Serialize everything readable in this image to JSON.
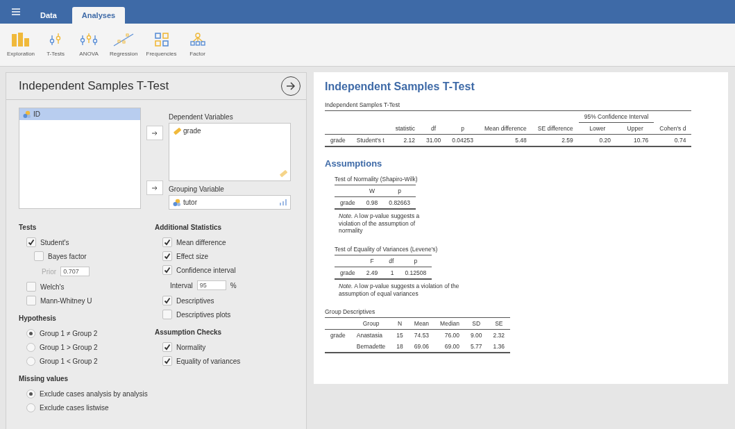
{
  "tabs": [
    {
      "label": "Data",
      "selected": false
    },
    {
      "label": "Analyses",
      "selected": true
    }
  ],
  "ribbon": [
    {
      "kind": "exploration",
      "label": "Exploration"
    },
    {
      "kind": "ttests",
      "label": "T-Tests"
    },
    {
      "kind": "anova",
      "label": "ANOVA"
    },
    {
      "kind": "regression",
      "label": "Regression"
    },
    {
      "kind": "frequencies",
      "label": "Frequencies"
    },
    {
      "kind": "factor",
      "label": "Factor"
    }
  ],
  "panel": {
    "title": "Independent Samples T-Test",
    "available": [
      {
        "name": "ID",
        "kind": "nominal",
        "selected": true
      }
    ],
    "dependent": {
      "label": "Dependent Variables",
      "items": [
        {
          "name": "grade",
          "kind": "scale"
        }
      ]
    },
    "grouping": {
      "label": "Grouping Variable",
      "items": [
        {
          "name": "tutor",
          "kind": "nominal"
        }
      ]
    }
  },
  "options": {
    "columns": [
      {
        "sections": [
          {
            "title": "Tests",
            "items": [
              {
                "kind": "checkbox",
                "label": "Student's",
                "checked": true,
                "children": [
                  {
                    "kind": "checkbox",
                    "label": "Bayes factor",
                    "checked": false,
                    "children": [
                      {
                        "kind": "field",
                        "label": "Prior",
                        "value": "0.707",
                        "disabled": true
                      }
                    ]
                  }
                ]
              },
              {
                "kind": "checkbox",
                "label": "Welch's",
                "checked": false
              },
              {
                "kind": "checkbox",
                "label": "Mann-Whitney U",
                "checked": false
              }
            ]
          },
          {
            "title": "Hypothesis",
            "items": [
              {
                "kind": "radio",
                "label": "Group 1 ≠ Group 2",
                "selected": true
              },
              {
                "kind": "radio",
                "label": "Group 1 > Group 2",
                "selected": false
              },
              {
                "kind": "radio",
                "label": "Group 1 < Group 2",
                "selected": false
              }
            ]
          },
          {
            "title": "Missing values",
            "items": [
              {
                "kind": "radio",
                "label": "Exclude cases analysis by analysis",
                "selected": true
              },
              {
                "kind": "radio",
                "label": "Exclude cases listwise",
                "selected": false
              }
            ]
          }
        ]
      },
      {
        "sections": [
          {
            "title": "Additional Statistics",
            "items": [
              {
                "kind": "checkbox",
                "label": "Mean difference",
                "checked": true
              },
              {
                "kind": "checkbox",
                "label": "Effect size",
                "checked": true
              },
              {
                "kind": "checkbox",
                "label": "Confidence interval",
                "checked": true,
                "children": [
                  {
                    "kind": "field",
                    "label": "Interval",
                    "value": "95",
                    "suffix": "%",
                    "disabled": false
                  }
                ]
              },
              {
                "kind": "checkbox",
                "label": "Descriptives",
                "checked": true
              },
              {
                "kind": "checkbox",
                "label": "Descriptives plots",
                "checked": false
              }
            ]
          },
          {
            "title": "Assumption Checks",
            "items": [
              {
                "kind": "checkbox",
                "label": "Normality",
                "checked": true
              },
              {
                "kind": "checkbox",
                "label": "Equality of variances",
                "checked": true
              }
            ]
          }
        ]
      }
    ]
  },
  "results": {
    "title": "Independent Samples T-Test",
    "main_table": {
      "title": "Independent Samples T-Test",
      "column_groups": [
        {
          "columns": [
            "",
            "",
            "statistic",
            "df",
            "p",
            "Mean difference",
            "SE difference"
          ]
        },
        {
          "label": "95% Confidence Interval",
          "columns": [
            "Lower",
            "Upper"
          ]
        },
        {
          "columns": [
            "Cohen's d"
          ]
        }
      ],
      "rows": [
        [
          "grade",
          "Student's t",
          "2.12",
          "31.00",
          "0.04253",
          "5.48",
          "2.59",
          "0.20",
          "10.76",
          "0.74"
        ]
      ]
    },
    "assumptions_title": "Assumptions",
    "assumption_tables": [
      {
        "title": "Test of Normality (Shapiro-Wilk)",
        "columns": [
          "",
          "W",
          "p"
        ],
        "rows": [
          [
            "grade",
            "0.98",
            "0.82663"
          ]
        ],
        "note": "*Note.* A low p-value suggests a violation of the assumption of normality"
      },
      {
        "title": "Test of Equality of Variances (Levene's)",
        "columns": [
          "",
          "F",
          "df",
          "p"
        ],
        "rows": [
          [
            "grade",
            "2.49",
            "1",
            "0.12508"
          ]
        ],
        "note": "*Note.* A low p-value suggests a violation of the assumption of equal variances"
      }
    ],
    "descriptives": {
      "title": "Group Descriptives",
      "columns": [
        "",
        "Group",
        "N",
        "Mean",
        "Median",
        "SD",
        "SE"
      ],
      "rows": [
        [
          "grade",
          "Anastasia",
          "15",
          "74.53",
          "76.00",
          "9.00",
          "2.32"
        ],
        [
          "",
          "Bernadette",
          "18",
          "69.06",
          "69.00",
          "5.77",
          "1.36"
        ]
      ]
    }
  }
}
